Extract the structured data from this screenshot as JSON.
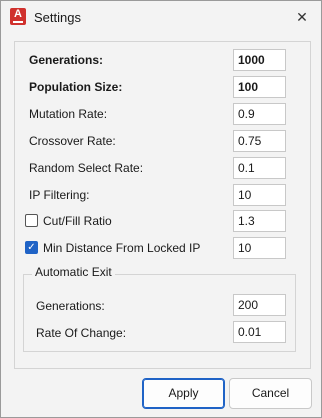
{
  "window": {
    "title": "Settings",
    "app_icon_letter": "A"
  },
  "form": {
    "generations": {
      "label": "Generations:",
      "value": "1000"
    },
    "population_size": {
      "label": "Population Size:",
      "value": "100"
    },
    "mutation_rate": {
      "label": "Mutation Rate:",
      "value": "0.9"
    },
    "crossover_rate": {
      "label": "Crossover Rate:",
      "value": "0.75"
    },
    "random_select_rate": {
      "label": "Random Select Rate:",
      "value": "0.1"
    },
    "ip_filtering": {
      "label": "IP Filtering:",
      "value": "10"
    },
    "cut_fill_ratio": {
      "label": "Cut/Fill Ratio",
      "value": "1.3",
      "checked": false
    },
    "min_distance": {
      "label": "Min Distance From Locked IP",
      "value": "10",
      "checked": true
    }
  },
  "automatic_exit": {
    "legend": "Automatic Exit",
    "generations": {
      "label": "Generations:",
      "value": "200"
    },
    "rate_of_change": {
      "label": "Rate Of Change:",
      "value": "0.01"
    }
  },
  "buttons": {
    "apply": "Apply",
    "cancel": "Cancel"
  },
  "colors": {
    "accent": "#1f63c6",
    "app_icon": "#d0312d"
  }
}
